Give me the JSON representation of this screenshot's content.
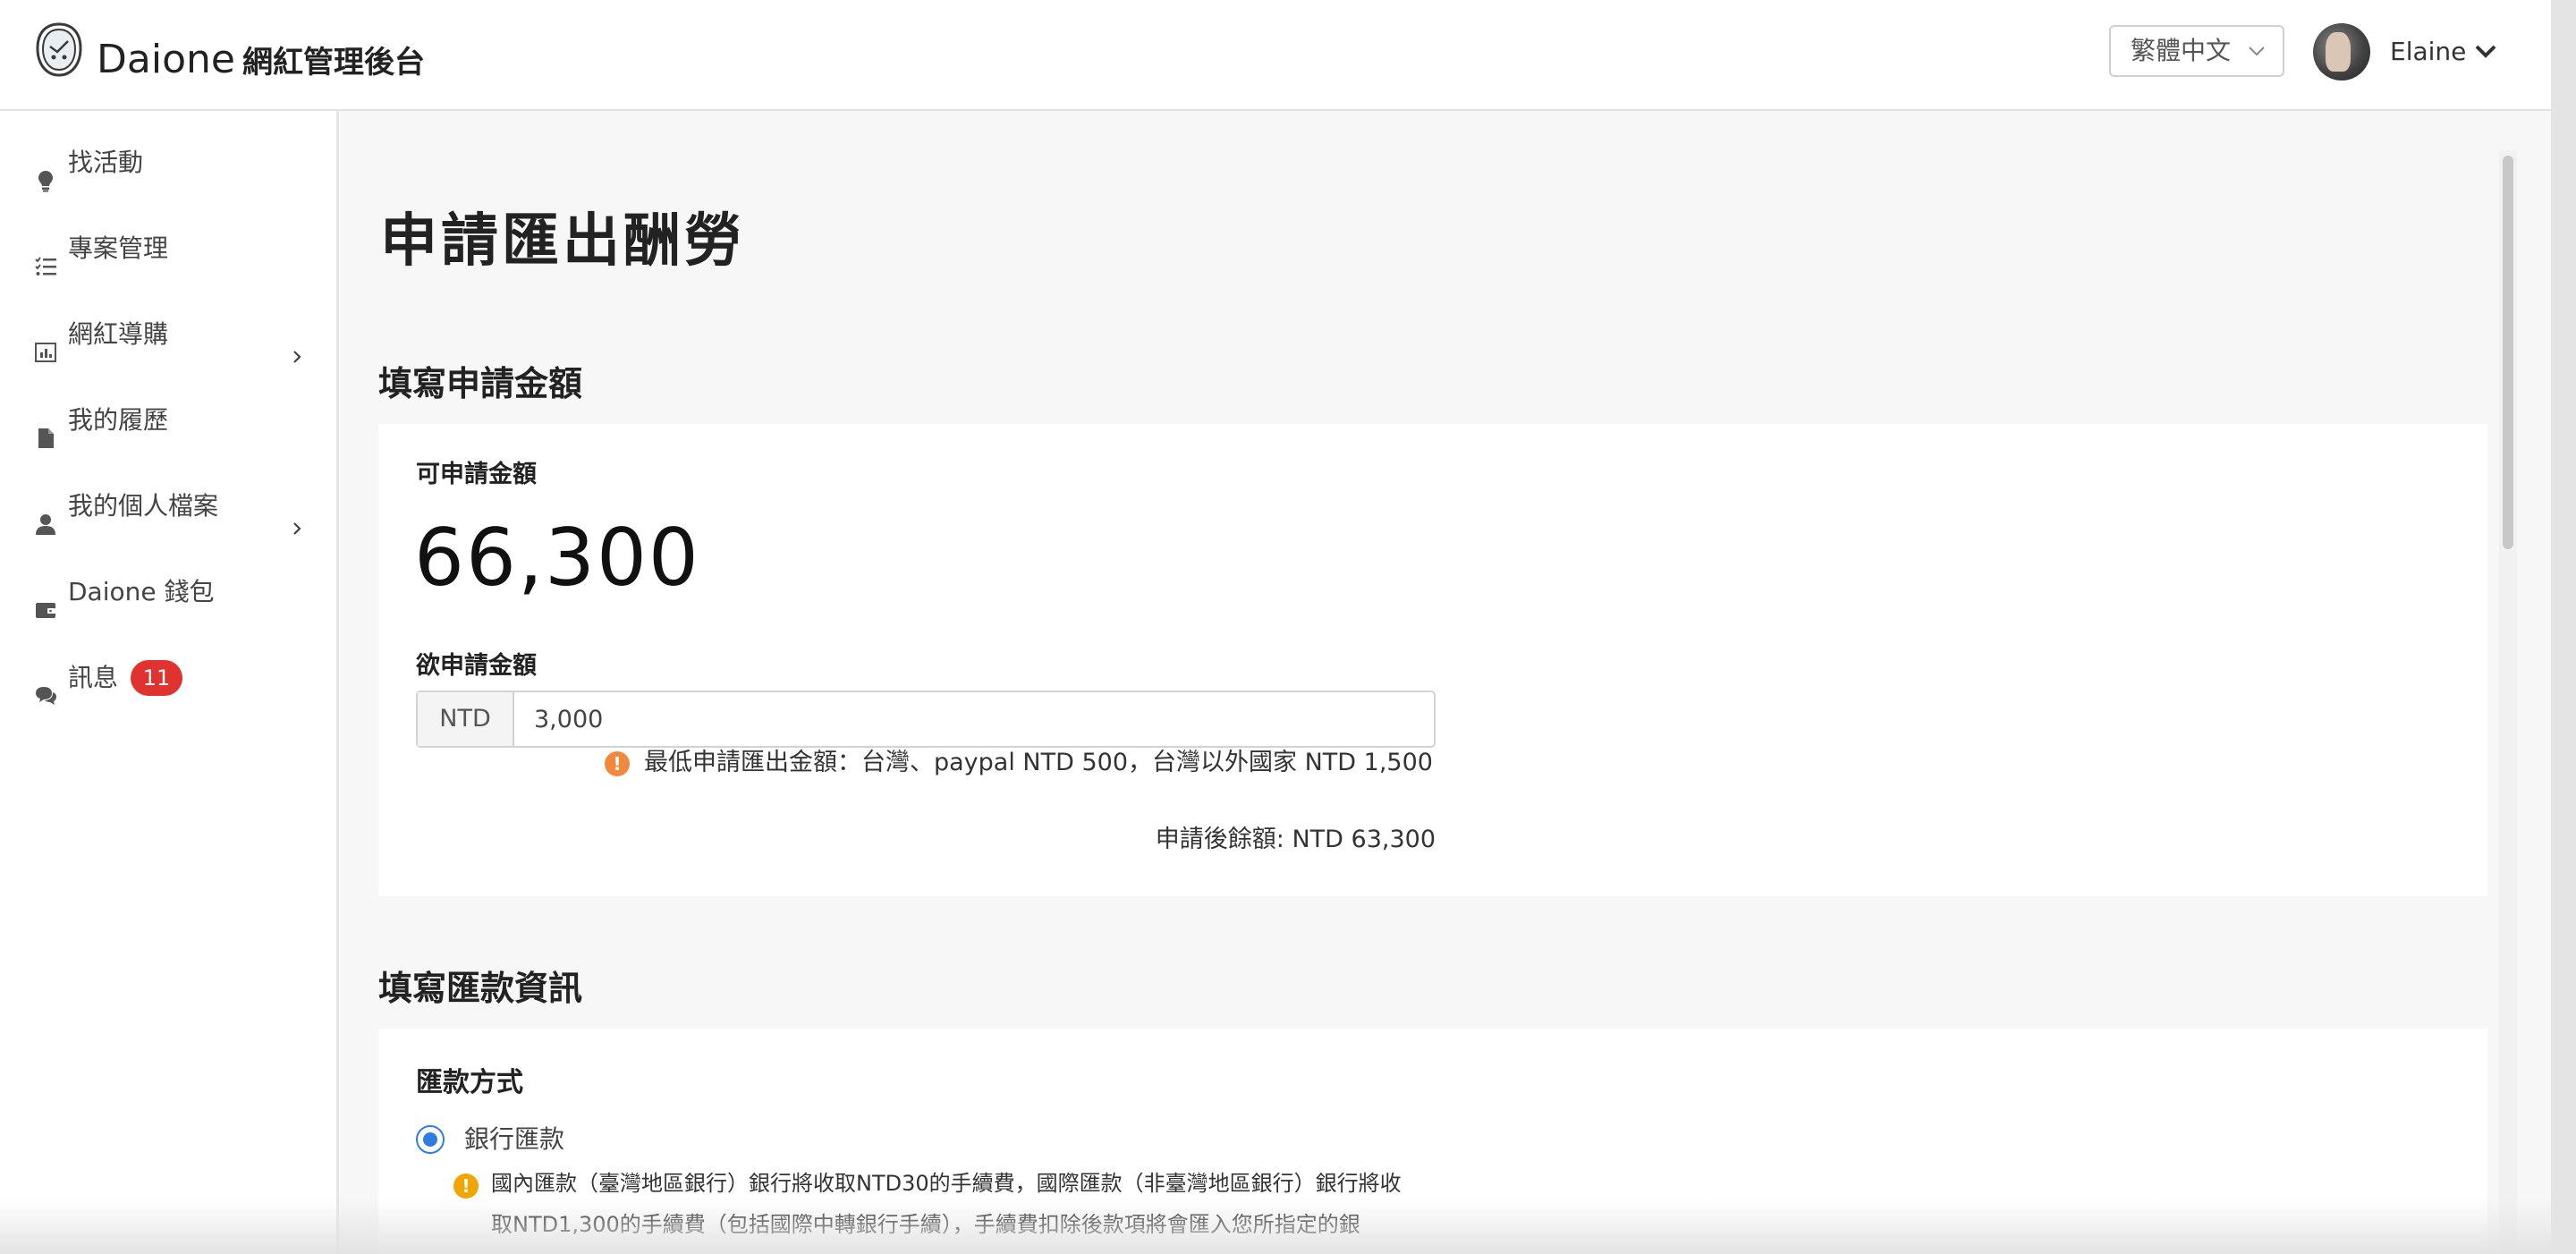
{
  "header": {
    "brand_name": "Daione",
    "brand_sub": "網紅管理後台",
    "language": "繁體中文",
    "user_name": "Elaine"
  },
  "sidebar": {
    "items": [
      {
        "label": "找活動",
        "icon": "lightbulb-icon",
        "has_arrow": false
      },
      {
        "label": "專案管理",
        "icon": "checklist-icon",
        "has_arrow": false
      },
      {
        "label": "網紅導購",
        "icon": "bar-chart-icon",
        "has_arrow": true
      },
      {
        "label": "我的履歷",
        "icon": "document-icon",
        "has_arrow": false
      },
      {
        "label": "我的個人檔案",
        "icon": "user-icon",
        "has_arrow": true
      },
      {
        "label": "Daione 錢包",
        "icon": "wallet-icon",
        "has_arrow": false
      },
      {
        "label": "訊息",
        "icon": "chat-icon",
        "has_arrow": false,
        "badge": "11"
      }
    ]
  },
  "main": {
    "page_title": "申請匯出酬勞",
    "amount_section": {
      "title": "填寫申請金額",
      "available_label": "可申請金額",
      "available_amount": "66,300",
      "request_label": "欲申請金額",
      "currency_prefix": "NTD",
      "request_value": "3,000",
      "min_note": "最低申請匯出金額：台灣、paypal NTD 500，台灣以外國家 NTD 1,500",
      "remaining": "申請後餘額: NTD 63,300"
    },
    "remit_section": {
      "title": "填寫匯款資訊",
      "method_label": "匯款方式",
      "option_bank": "銀行匯款",
      "fee_note_line1": "國內匯款（臺灣地區銀行）銀行將收取NTD30的手續費，國際匯款（非臺灣地區銀行）銀行將收",
      "fee_note_line2": "取NTD1,300的手續費（包括國際中轉銀行手續），手續費扣除後款項將會匯入您所指定的銀"
    }
  },
  "colors": {
    "accent_blue": "#2f7de1",
    "badge_red": "#e0322f",
    "warning_orange": "#f0883e",
    "warning_amber": "#f0a500"
  }
}
